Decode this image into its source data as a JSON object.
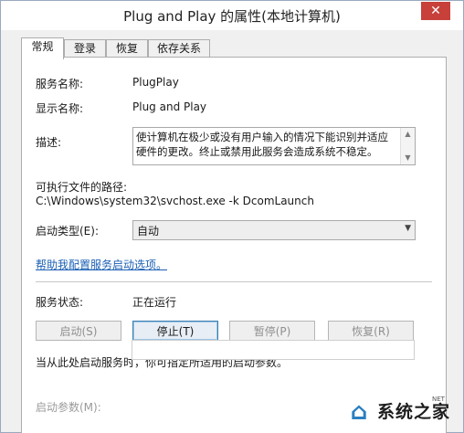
{
  "window": {
    "title": "Plug and Play 的属性(本地计算机)",
    "close_label": "✕"
  },
  "tabs": [
    {
      "label": "常规"
    },
    {
      "label": "登录"
    },
    {
      "label": "恢复"
    },
    {
      "label": "依存关系"
    }
  ],
  "general": {
    "service_name_label": "服务名称:",
    "service_name_value": "PlugPlay",
    "display_name_label": "显示名称:",
    "display_name_value": "Plug and Play",
    "description_label": "描述:",
    "description_value": "使计算机在极少或没有用户输入的情况下能识别并适应硬件的更改。终止或禁用此服务会造成系统不稳定。",
    "exe_path_label": "可执行文件的路径:",
    "exe_path_value": "C:\\Windows\\system32\\svchost.exe -k DcomLaunch",
    "startup_type_label": "启动类型(E):",
    "startup_type_value": "自动",
    "help_link": "帮助我配置服务启动选项。",
    "status_label": "服务状态:",
    "status_value": "正在运行",
    "buttons": {
      "start": "启动(S)",
      "stop": "停止(T)",
      "pause": "暂停(P)",
      "resume": "恢复(R)"
    },
    "hint_text": "当从此处启动服务时，你可指定所适用的启动参数。",
    "start_params_label": "启动参数(M):",
    "start_params_value": ""
  },
  "watermark": {
    "text": "系统之家",
    "sub": "NET"
  },
  "colors": {
    "link": "#1a5fb4",
    "close_button": "#c7403a",
    "focused_button_border": "#3c7fb1"
  }
}
